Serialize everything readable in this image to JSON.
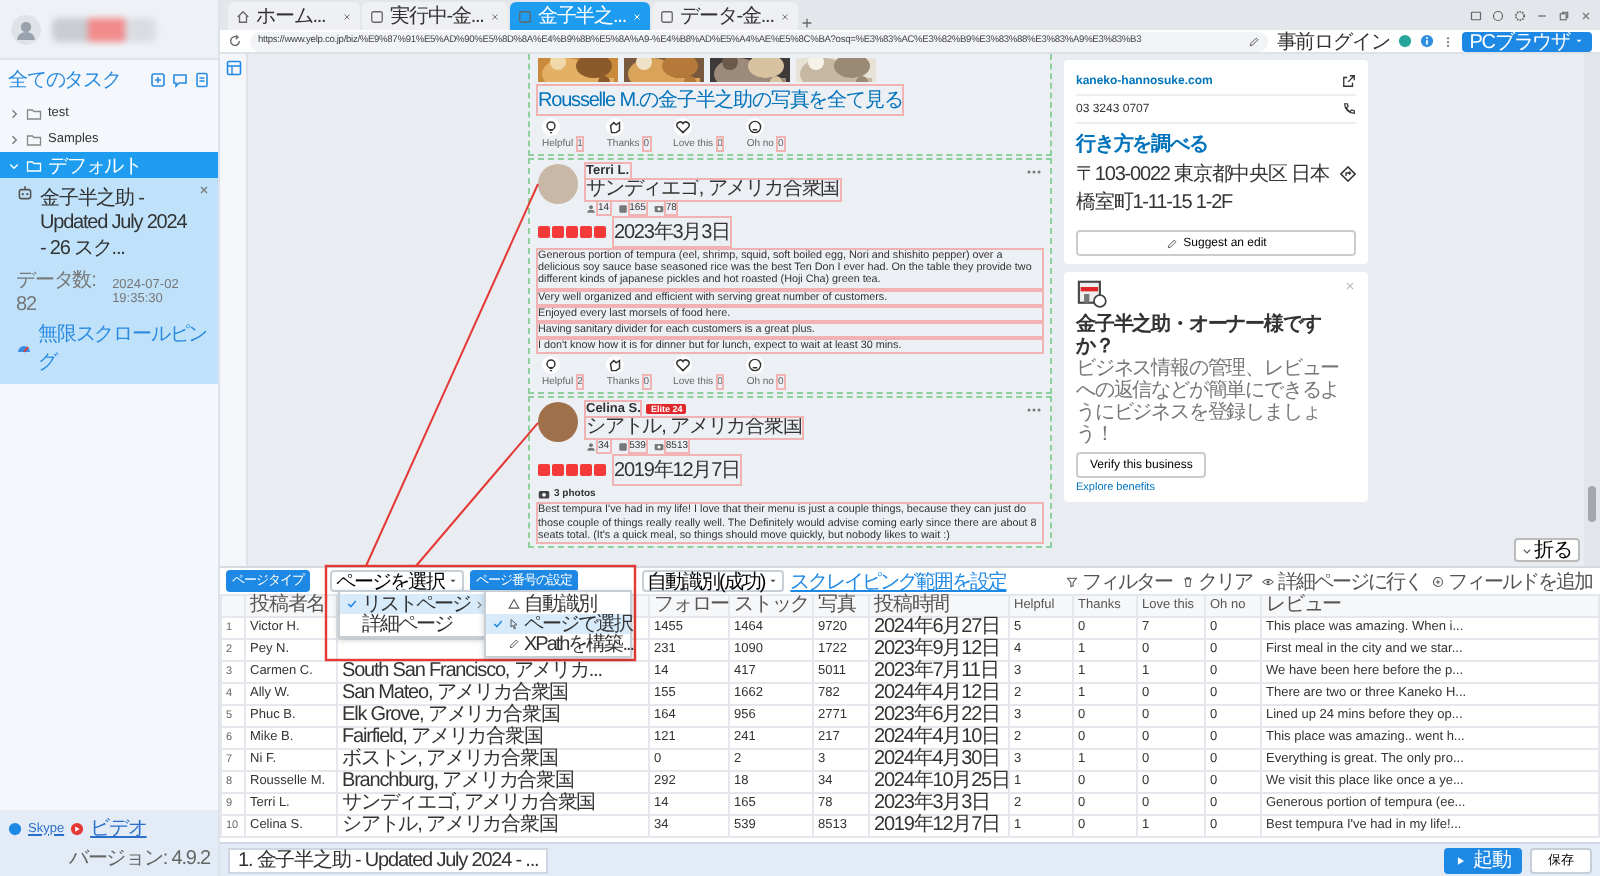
{
  "sidebar": {
    "title": "全てのタスク",
    "folders": [
      {
        "label": "test",
        "expanded": false,
        "selected": false
      },
      {
        "label": "Samples",
        "expanded": false,
        "selected": false
      },
      {
        "label": "デフォルト",
        "expanded": true,
        "selected": true,
        "children": [
          {
            "title": "金子半之助 - Updated July 2024 - 26 スク...",
            "count_label": "データ数: 82",
            "time": "2024-07-02 19:35:30",
            "mode": "無限スクロールピング",
            "selected": true
          }
        ]
      }
    ],
    "links": [
      "Skype",
      "ビデオ"
    ],
    "version": "バージョン: 4.9.2"
  },
  "browser": {
    "tabs": [
      {
        "kind": "home",
        "label": "ホーム...",
        "selected": false
      },
      {
        "kind": "page",
        "label": "実行中-金...",
        "selected": false
      },
      {
        "kind": "page",
        "label": "金子半之...",
        "selected": true
      },
      {
        "kind": "page",
        "label": "データ-金...",
        "selected": false
      }
    ],
    "url": "https://www.yelp.co.jp/biz/%E9%87%91%E5%AD%90%E5%8D%8A%E4%B9%8B%E5%8A%A9-%E4%B8%AD%E5%A4%AE%E5%8C%BA?osq=%E3%83%AC%E3%82%B9%E3%83%88%E3%83%A9%E3%83%B3",
    "pre_login": "事前ログイン",
    "mode_button": "PCブラウザ"
  },
  "page": {
    "photo_link": "Rousselle M.の金子半之助の写真を全て見る",
    "first_reactions": [
      {
        "label": "Helpful",
        "count": "1"
      },
      {
        "label": "Thanks",
        "count": "0"
      },
      {
        "label": "Love this",
        "count": "0"
      },
      {
        "label": "Oh no",
        "count": "0"
      }
    ],
    "reviews": [
      {
        "name": "Terri L.",
        "location": "サンディエゴ, アメリカ合衆国",
        "friends": "14",
        "reviews": "165",
        "photos": "78",
        "stars": 5,
        "date": "2023年3月3日",
        "paragraphs": [
          "Generous portion of tempura (eel, shrimp, squid, soft boiled egg, Nori and shishito pepper) over a delicious soy sauce base seasoned rice was the best Ten Don I ever had. On the table they provide two different kinds of japanese pickles and hot roasted (Hoji Cha) green tea.",
          "Very well organized and efficient with serving great number of customers.",
          "Enjoyed every last morsels of food here.",
          "Having sanitary divider for each customers is a great plus.",
          "I don't know how it is for dinner but for lunch, expect to wait at least 30 mins."
        ],
        "reactions": [
          {
            "label": "Helpful",
            "count": "2"
          },
          {
            "label": "Thanks",
            "count": "0"
          },
          {
            "label": "Love this",
            "count": "0"
          },
          {
            "label": "Oh no",
            "count": "0"
          }
        ]
      },
      {
        "name": "Celina S.",
        "badge": "Elite 24",
        "location": "シアトル, アメリカ合衆国",
        "friends": "34",
        "reviews": "539",
        "photos": "8513",
        "stars": 5,
        "date": "2019年12月7日",
        "photo_count": "3 photos",
        "paragraphs": [
          "Best tempura I've had in my life! I love that their menu is just a couple things, because they can just do those couple of things really really well. The Definitely would advise coming early since there are about 8 seats total. (It's a quick meal, so things should move quickly, but nobody likes to wait :)"
        ]
      }
    ],
    "business": {
      "website": "kaneko-hannosuke.com",
      "phone": "03 3243 0707",
      "directions": "行き方を調べる",
      "address": "〒103-0022 東京都中央区 日本橋室町1-11-15 1-2F",
      "suggest": "Suggest an edit"
    },
    "claim": {
      "title": "金子半之助・オーナー様ですか？",
      "body": "ビジネス情報の管理、レビューへの返信などが簡単にできるようにビジネスを登録しましょう！",
      "verify": "Verify this business",
      "explore": "Explore benefits"
    },
    "collapse": "折る"
  },
  "panel": {
    "page_type": "ページタイプ",
    "page_select": "ページを選択",
    "page_number": "ページ番号の設定",
    "auto_select": "自動識別(成功)",
    "range_link": "スクレイピング範囲を設定",
    "actions": [
      {
        "kind": "filter",
        "label": "フィルター"
      },
      {
        "kind": "clear",
        "label": "クリア"
      },
      {
        "kind": "detail",
        "label": "詳細ページに行く"
      },
      {
        "kind": "add",
        "label": "フィールドを追加"
      }
    ],
    "page_menu": [
      {
        "label": "リストページ",
        "selected": true,
        "submenu": true
      },
      {
        "label": "詳細ページ",
        "selected": false,
        "submenu": false
      }
    ],
    "sub_menu": [
      {
        "kind": "auto",
        "label": "自動識別",
        "selected": false
      },
      {
        "kind": "pick",
        "label": "ページで選択",
        "selected": true
      },
      {
        "kind": "xpath",
        "label": "XPathを構築...",
        "selected": false
      }
    ],
    "columns": {
      "name": "投稿者名",
      "follow": "フォロー",
      "stock": "ストック",
      "photo": "写真",
      "time": "投稿時間",
      "helpful": "Helpful",
      "thanks": "Thanks",
      "love": "Love this",
      "oh_no": "Oh no",
      "review": "レビュー"
    },
    "rows": [
      {
        "index": "1",
        "name": "Victor H.",
        "follow": "1455",
        "stock": "1464",
        "photo": "9720",
        "time": "2024年6月27日",
        "helpful": "5",
        "thanks": "0",
        "love": "7",
        "oh_no": "0",
        "review": "This place was amazing. When i..."
      },
      {
        "index": "2",
        "name": "Pey N.",
        "follow": "231",
        "stock": "1090",
        "photo": "1722",
        "time": "2023年9月12日",
        "helpful": "4",
        "thanks": "1",
        "love": "0",
        "oh_no": "0",
        "review": "First meal in the city and we star..."
      },
      {
        "index": "3",
        "name": "Carmen C.",
        "location": "South San Francisco, アメリカ...",
        "follow": "14",
        "stock": "417",
        "photo": "5011",
        "time": "2023年7月11日",
        "helpful": "3",
        "thanks": "1",
        "love": "1",
        "oh_no": "0",
        "review": "We have been here before the p..."
      },
      {
        "index": "4",
        "name": "Ally W.",
        "location": "San Mateo, アメリカ合衆国",
        "follow": "155",
        "stock": "1662",
        "photo": "782",
        "time": "2024年4月12日",
        "helpful": "2",
        "thanks": "1",
        "love": "0",
        "oh_no": "0",
        "review": "There are two or three Kaneko H..."
      },
      {
        "index": "5",
        "name": "Phuc B.",
        "location": "Elk Grove, アメリカ合衆国",
        "follow": "164",
        "stock": "956",
        "photo": "2771",
        "time": "2023年6月22日",
        "helpful": "3",
        "thanks": "0",
        "love": "0",
        "oh_no": "0",
        "review": "Lined up 24 mins before they op..."
      },
      {
        "index": "6",
        "name": "Mike B.",
        "location": "Fairfield, アメリカ合衆国",
        "follow": "121",
        "stock": "241",
        "photo": "217",
        "time": "2024年4月10日",
        "helpful": "2",
        "thanks": "0",
        "love": "0",
        "oh_no": "0",
        "review": "This place was amazing.. went h..."
      },
      {
        "index": "7",
        "name": "Ni F.",
        "location": "ボストン, アメリカ合衆国",
        "follow": "0",
        "stock": "2",
        "photo": "3",
        "time": "2024年4月30日",
        "helpful": "3",
        "thanks": "1",
        "love": "0",
        "oh_no": "0",
        "review": "Everything is great. The only pro..."
      },
      {
        "index": "8",
        "name": "Rousselle M.",
        "location": "Branchburg, アメリカ合衆国",
        "follow": "292",
        "stock": "18",
        "photo": "34",
        "time": "2024年10月25日",
        "helpful": "1",
        "thanks": "0",
        "love": "0",
        "oh_no": "0",
        "review": "We visit this place like once a ye..."
      },
      {
        "index": "9",
        "name": "Terri L.",
        "location": "サンディエゴ, アメリカ合衆国",
        "follow": "14",
        "stock": "165",
        "photo": "78",
        "time": "2023年3月3日",
        "helpful": "2",
        "thanks": "0",
        "love": "0",
        "oh_no": "0",
        "review": "Generous portion of tempura (ee..."
      },
      {
        "index": "10",
        "name": "Celina S.",
        "location": "シアトル, アメリカ合衆国",
        "follow": "34",
        "stock": "539",
        "photo": "8513",
        "time": "2019年12月7日",
        "helpful": "1",
        "thanks": "0",
        "love": "1",
        "oh_no": "0",
        "review": "Best tempura I've had in my life!..."
      }
    ]
  },
  "footer": {
    "task_tab": "1. 金子半之助 - Updated July 2024 - ...",
    "start": "起動",
    "save": "保存"
  }
}
